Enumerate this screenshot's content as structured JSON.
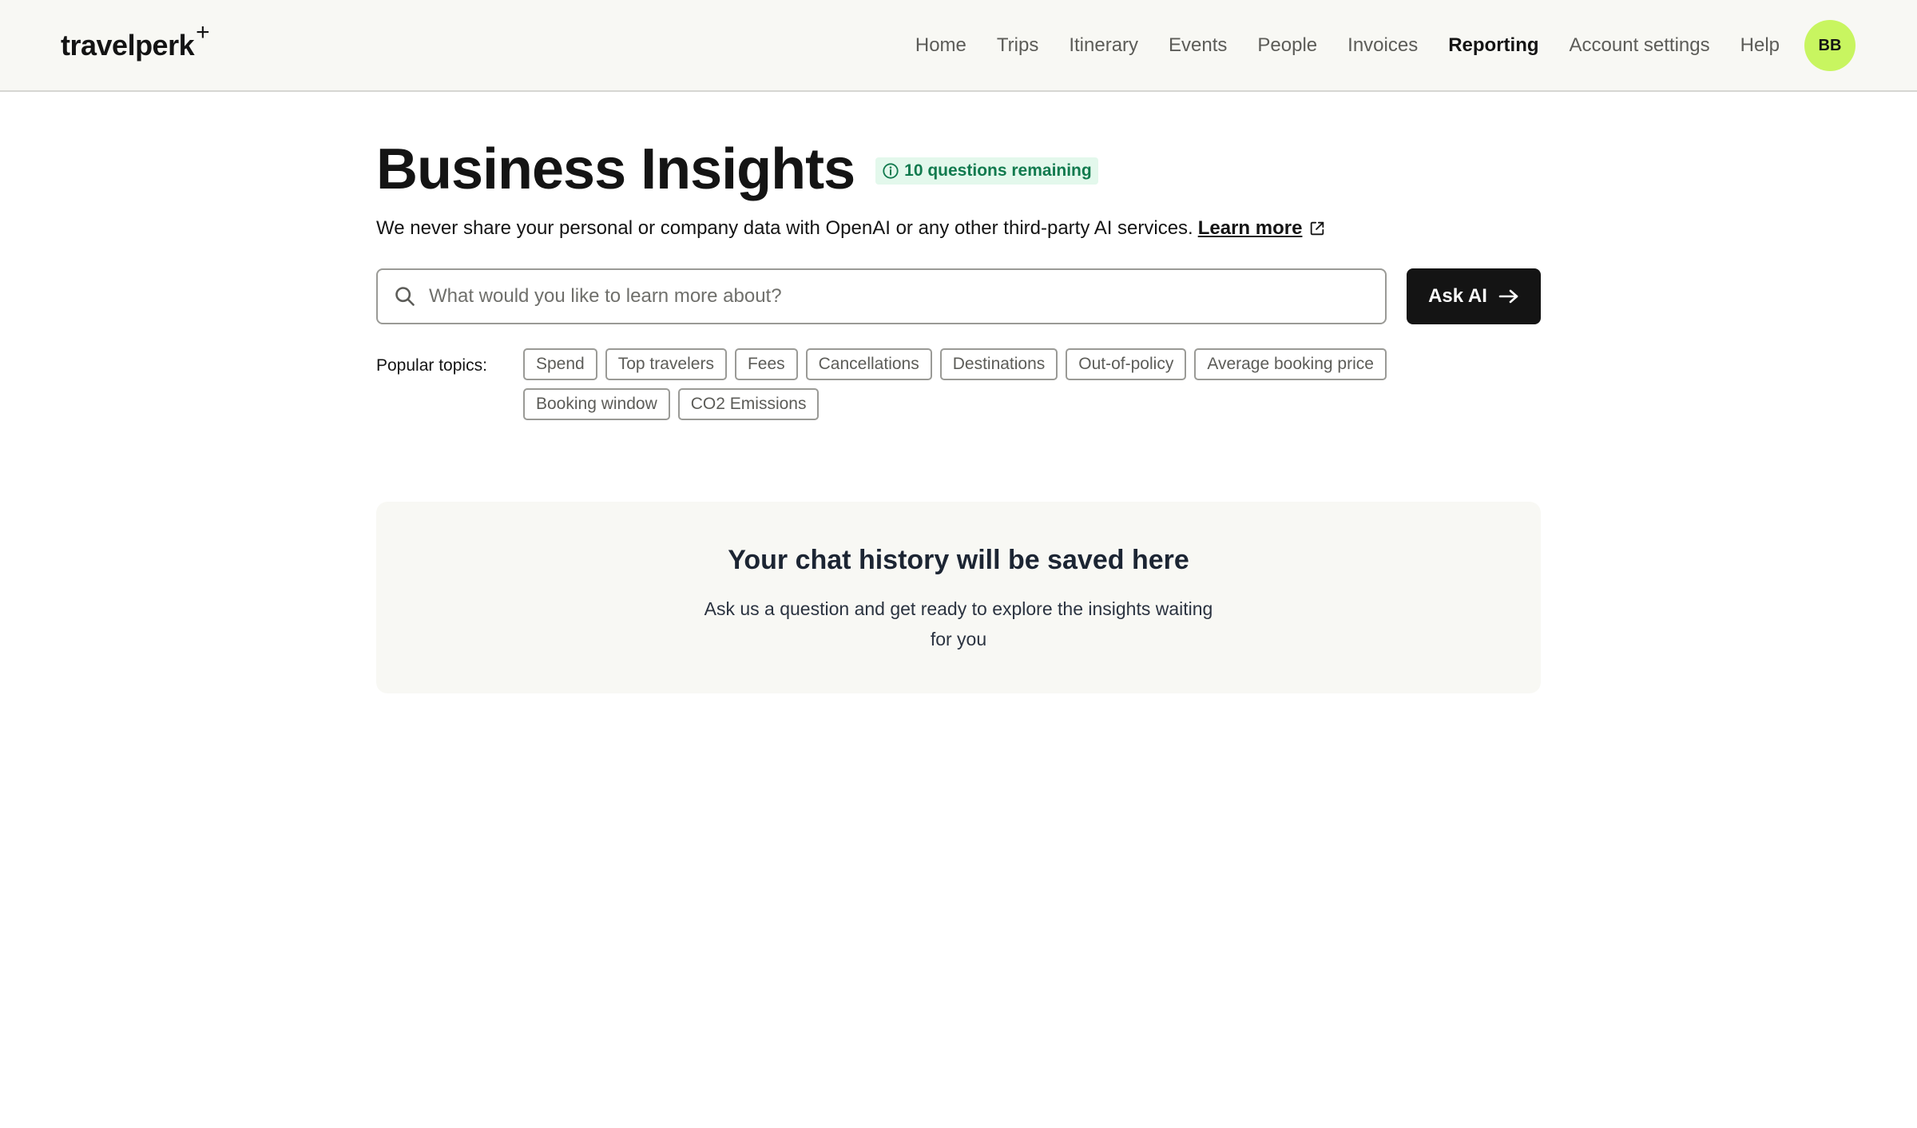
{
  "header": {
    "logo_text": "travelperk",
    "logo_mark": "+",
    "nav": [
      {
        "label": "Home",
        "active": false
      },
      {
        "label": "Trips",
        "active": false
      },
      {
        "label": "Itinerary",
        "active": false
      },
      {
        "label": "Events",
        "active": false
      },
      {
        "label": "People",
        "active": false
      },
      {
        "label": "Invoices",
        "active": false
      },
      {
        "label": "Reporting",
        "active": true
      },
      {
        "label": "Account settings",
        "active": false
      },
      {
        "label": "Help",
        "active": false
      }
    ],
    "avatar_initials": "BB",
    "avatar_color": "#c8f560"
  },
  "page": {
    "title": "Business Insights",
    "badge": {
      "text": "10 questions remaining",
      "icon": "info-icon",
      "color": "#117a4e",
      "background": "#e3f8ec"
    },
    "disclaimer": "We never share your personal or company data with OpenAI or any other third-party AI services.",
    "learn_more": "Learn more",
    "learn_more_icon": "external-link-icon"
  },
  "search": {
    "icon": "search-icon",
    "placeholder": "What would you like to learn more about?",
    "value": "",
    "button_label": "Ask AI",
    "button_icon": "arrow-right-icon"
  },
  "topics": {
    "label": "Popular topics:",
    "items": [
      "Spend",
      "Top travelers",
      "Fees",
      "Cancellations",
      "Destinations",
      "Out-of-policy",
      "Average booking price",
      "Booking window",
      "CO2 Emissions"
    ]
  },
  "history": {
    "title": "Your chat history will be saved here",
    "subtitle": "Ask us a question and get ready to explore the insights waiting for you"
  }
}
